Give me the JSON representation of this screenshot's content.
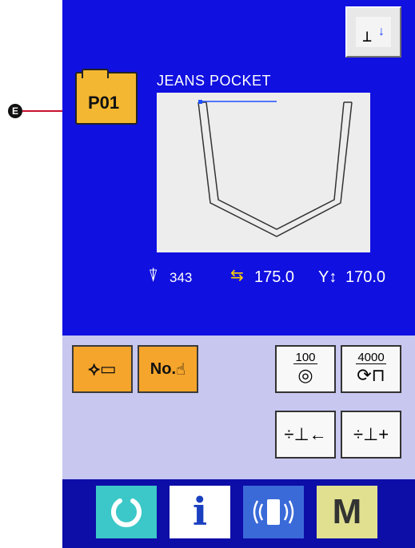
{
  "callout": {
    "label": "E"
  },
  "pattern": {
    "number": "P01",
    "name": "JEANS POCKET"
  },
  "status": {
    "stitch_count": "343",
    "x_scale": "175.0",
    "y_scale": "170.0"
  },
  "counters": {
    "bobbin_counter": "100",
    "sewing_counter": "4000"
  },
  "orange_buttons": {
    "number_button_label": "No."
  },
  "bottom_bar": {
    "info_label": "i",
    "mode_label": "M"
  }
}
